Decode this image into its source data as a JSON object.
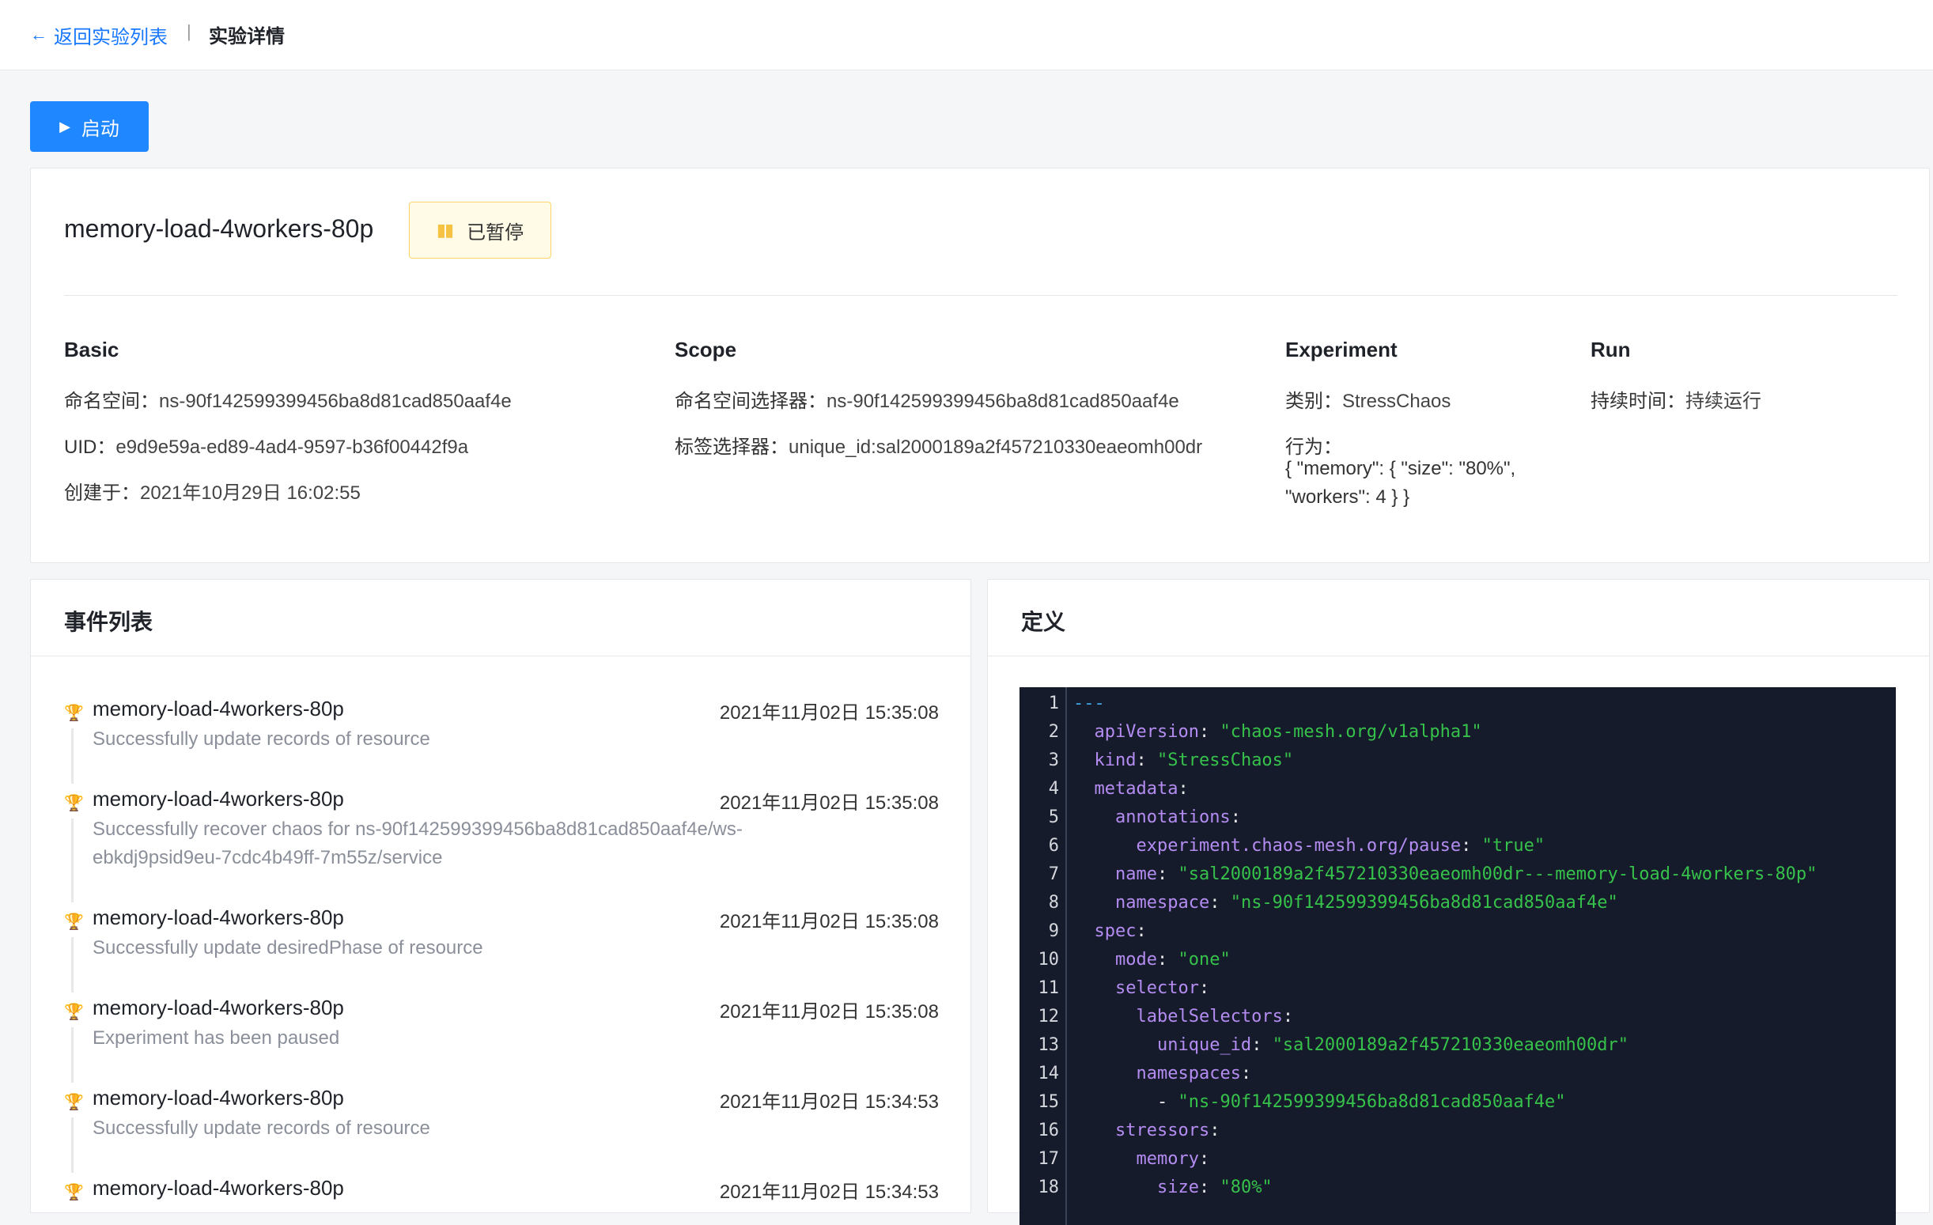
{
  "breadcrumb": {
    "back_label": "返回实验列表",
    "separator": "|",
    "current": "实验详情"
  },
  "toolbar": {
    "start_label": "启动"
  },
  "experiment": {
    "name": "memory-load-4workers-80p",
    "status": "已暂停",
    "basic": {
      "title": "Basic",
      "namespace_label": "命名空间：",
      "namespace": "ns-90f142599399456ba8d81cad850aaf4e",
      "uid_label": "UID：",
      "uid": "e9d9e59a-ed89-4ad4-9597-b36f00442f9a",
      "created_label": "创建于：",
      "created": "2021年10月29日 16:02:55"
    },
    "scope": {
      "title": "Scope",
      "ns_selector_label": "命名空间选择器：",
      "ns_selector": "ns-90f142599399456ba8d81cad850aaf4e",
      "label_selector_label": "标签选择器：",
      "label_selector": "unique_id:sal2000189a2f457210330eaeomh00dr"
    },
    "experiment_section": {
      "title": "Experiment",
      "kind_label": "类别：",
      "kind": "StressChaos",
      "action_label": "行为：",
      "action": "{ \"memory\": { \"size\": \"80%\", \"workers\": 4 } }"
    },
    "run": {
      "title": "Run",
      "duration_label": "持续时间：",
      "duration": "持续运行"
    }
  },
  "events": {
    "title": "事件列表",
    "items": [
      {
        "name": "memory-load-4workers-80p",
        "time": "2021年11月02日 15:35:08",
        "message": "Successfully update records of resource"
      },
      {
        "name": "memory-load-4workers-80p",
        "time": "2021年11月02日 15:35:08",
        "message": "Successfully recover chaos for ns-90f142599399456ba8d81cad850aaf4e/ws-ebkdj9psid9eu-7cdc4b49ff-7m55z/service"
      },
      {
        "name": "memory-load-4workers-80p",
        "time": "2021年11月02日 15:35:08",
        "message": "Successfully update desiredPhase of resource"
      },
      {
        "name": "memory-load-4workers-80p",
        "time": "2021年11月02日 15:35:08",
        "message": "Experiment has been paused"
      },
      {
        "name": "memory-load-4workers-80p",
        "time": "2021年11月02日 15:34:53",
        "message": "Successfully update records of resource"
      },
      {
        "name": "memory-load-4workers-80p",
        "time": "2021年11月02日 15:34:53",
        "message": ""
      }
    ]
  },
  "definition": {
    "title": "定义",
    "lines": [
      {
        "n": "1",
        "indent": "",
        "key": "",
        "val": "",
        "dash": "---"
      },
      {
        "n": "2",
        "indent": "  ",
        "key": "apiVersion",
        "val": "\"chaos-mesh.org/v1alpha1\""
      },
      {
        "n": "3",
        "indent": "  ",
        "key": "kind",
        "val": "\"StressChaos\""
      },
      {
        "n": "4",
        "indent": "  ",
        "key": "metadata",
        "val": ""
      },
      {
        "n": "5",
        "indent": "    ",
        "key": "annotations",
        "val": ""
      },
      {
        "n": "6",
        "indent": "      ",
        "key": "experiment.chaos-mesh.org/pause",
        "val": "\"true\""
      },
      {
        "n": "7",
        "indent": "    ",
        "key": "name",
        "val": "\"sal2000189a2f457210330eaeomh00dr---memory-load-4workers-80p\""
      },
      {
        "n": "8",
        "indent": "    ",
        "key": "namespace",
        "val": "\"ns-90f142599399456ba8d81cad850aaf4e\""
      },
      {
        "n": "9",
        "indent": "  ",
        "key": "spec",
        "val": ""
      },
      {
        "n": "10",
        "indent": "    ",
        "key": "mode",
        "val": "\"one\""
      },
      {
        "n": "11",
        "indent": "    ",
        "key": "selector",
        "val": ""
      },
      {
        "n": "12",
        "indent": "      ",
        "key": "labelSelectors",
        "val": ""
      },
      {
        "n": "13",
        "indent": "        ",
        "key": "unique_id",
        "val": "\"sal2000189a2f457210330eaeomh00dr\""
      },
      {
        "n": "14",
        "indent": "      ",
        "key": "namespaces",
        "val": ""
      },
      {
        "n": "15",
        "indent": "        ",
        "key": "",
        "val": "\"ns-90f142599399456ba8d81cad850aaf4e\"",
        "list": "- "
      },
      {
        "n": "16",
        "indent": "    ",
        "key": "stressors",
        "val": ""
      },
      {
        "n": "17",
        "indent": "      ",
        "key": "memory",
        "val": ""
      },
      {
        "n": "18",
        "indent": "        ",
        "key": "size",
        "val": "\"80%\""
      }
    ]
  },
  "colors": {
    "accent": "#1f87ff",
    "paused_bg": "#fffbe6",
    "paused_border": "#ffd666",
    "event_dot": "#3aa52a",
    "code_bg": "#151b2b",
    "code_key": "#b48cf2",
    "code_string": "#36c24a"
  },
  "icons": {
    "back": "arrow-left-icon",
    "start": "play-icon",
    "status": "pause-icon",
    "event": "trophy-icon"
  }
}
